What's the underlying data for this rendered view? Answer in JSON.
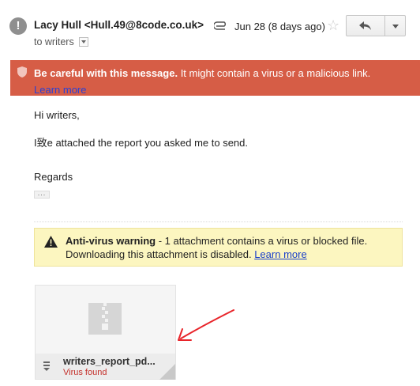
{
  "header": {
    "avatar_glyph": "!",
    "sender": "Lacy Hull <Hull.49@8code.co.uk>",
    "to_line": "to writers",
    "date": "Jun 28 (8 days ago)",
    "icons": {
      "attachment": "paperclip-icon",
      "star": "star-icon",
      "reply": "reply-icon",
      "more": "chevron-down-icon"
    }
  },
  "warning_banner": {
    "bold": "Be careful with this message.",
    "text": " It might contain a virus or a malicious link.",
    "link": "Learn more",
    "color": "#d65d46"
  },
  "message": {
    "greeting": "Hi writers,",
    "line1": "I致e attached the report you asked me to send.",
    "closing": "Regards",
    "ellipsis": "..."
  },
  "antivirus": {
    "title": "Anti-virus warning",
    "text1": " - 1 attachment contains a virus or blocked file.",
    "text2": "Downloading this attachment is disabled. ",
    "link": "Learn more",
    "background": "#fcf6c0"
  },
  "attachment": {
    "filename": "writers_report_pd...",
    "status": "Virus found",
    "status_color": "#c4302b"
  },
  "annotation": {
    "arrow_color": "#e8242a"
  }
}
